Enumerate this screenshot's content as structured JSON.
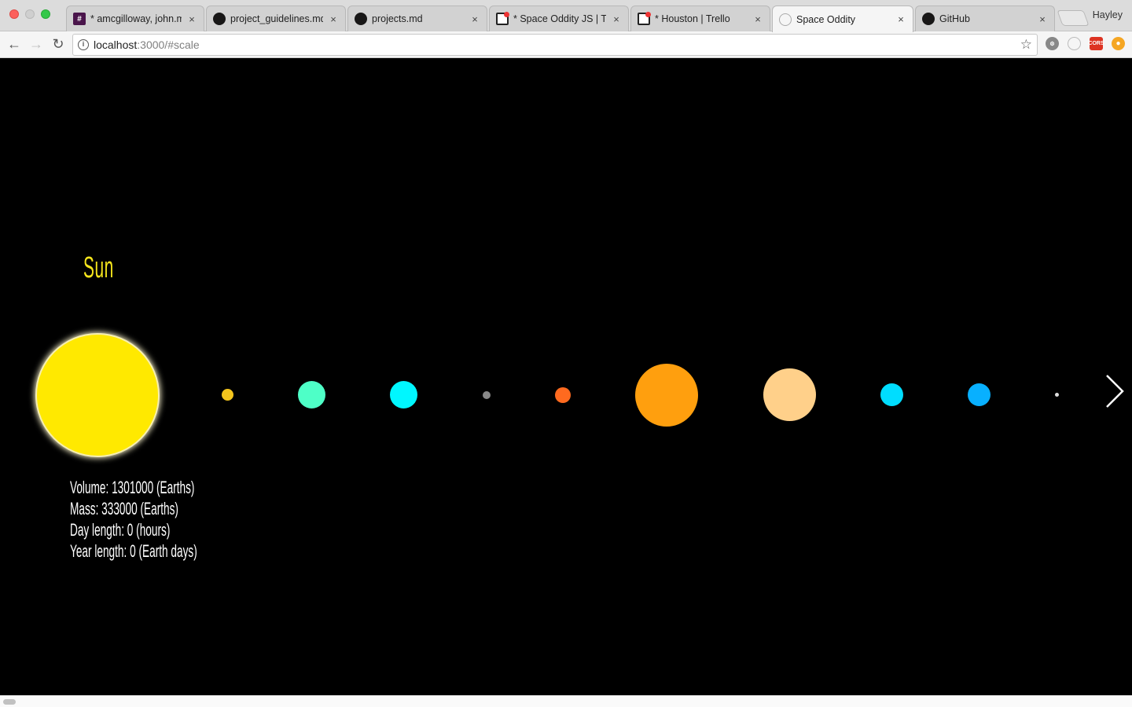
{
  "browser": {
    "tabs": [
      {
        "title": "* amcgilloway, john.m",
        "favicon": "slack-icon",
        "active": false
      },
      {
        "title": "project_guidelines.md",
        "favicon": "github-icon",
        "active": false
      },
      {
        "title": "projects.md",
        "favicon": "github-icon",
        "active": false
      },
      {
        "title": "* Space Oddity JS | Tr",
        "favicon": "trello-icon",
        "active": false
      },
      {
        "title": "* Houston | Trello",
        "favicon": "trello-icon",
        "active": false
      },
      {
        "title": "Space Oddity",
        "favicon": "loading-icon",
        "active": true
      },
      {
        "title": "GitHub",
        "favicon": "github-icon",
        "active": false
      }
    ],
    "close_glyph": "×",
    "profile": "Hayley",
    "url_host": "localhost",
    "url_rest": ":3000/#scale",
    "extensions": {
      "cors": "CORS"
    }
  },
  "page": {
    "planet_name": "Sun",
    "stats": {
      "volume": "Volume: 1301000 (Earths)",
      "mass": "Mass: 333000 (Earths)",
      "day_length": "Day length: 0 (hours)",
      "year_length": "Year length: 0 (Earth days)"
    },
    "bodies": [
      {
        "name": "sun",
        "color": "#ffe900"
      },
      {
        "name": "mercury",
        "color": "#f4c51d"
      },
      {
        "name": "venus",
        "color": "#4effc7"
      },
      {
        "name": "earth",
        "color": "#00f7ff"
      },
      {
        "name": "moon",
        "color": "#888888"
      },
      {
        "name": "mars",
        "color": "#ff6a1f"
      },
      {
        "name": "jupiter",
        "color": "#ff9f0e"
      },
      {
        "name": "saturn",
        "color": "#ffd08a"
      },
      {
        "name": "uranus",
        "color": "#00ddff"
      },
      {
        "name": "neptune",
        "color": "#08b0ff"
      },
      {
        "name": "pluto",
        "color": "#dddddd"
      }
    ],
    "colors": {
      "title": "#f5e51c",
      "background": "#000000"
    }
  }
}
